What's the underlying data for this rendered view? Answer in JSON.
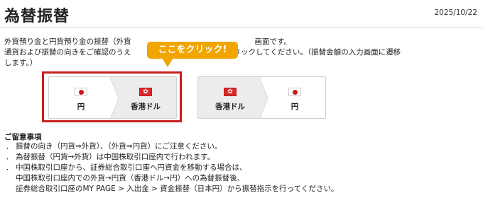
{
  "header": {
    "title": "為替振替",
    "date": "2025/10/22"
  },
  "description": {
    "line1": "外貨預り金と円貨預り金の振替（外貨",
    "line1_tail": "画面です。",
    "line2": "通貨および振替の向きをご確認のうえ",
    "line2_tail": "タンをクリックしてください。（振替金額の入力画面に遷移",
    "line3": "します。）"
  },
  "callout": {
    "text": "ここをクリック!"
  },
  "transfers": [
    {
      "from": {
        "label": "円",
        "flag": "japan-flag"
      },
      "to": {
        "label": "香港ドル",
        "flag": "hong-kong-flag"
      }
    },
    {
      "from": {
        "label": "香港ドル",
        "flag": "hong-kong-flag"
      },
      "to": {
        "label": "円",
        "flag": "japan-flag"
      }
    }
  ],
  "notes": {
    "title": "ご留意事項",
    "bullet": "．",
    "items": [
      {
        "text": "振替の向き（円貨⇒外貨）、（外貨⇒円貨）にご注意ください。"
      },
      {
        "text": "為替振替（円貨→外貨）は中国株取引口座内で行われます。"
      },
      {
        "text": "中国株取引口座から、証券総合取引口座へ円資金を移動する場合は、",
        "text2": "中国株取引口座内での外貨→円貨（香港ドル→円）への為替振替後、",
        "text3": "証券総合取引口座のMY PAGE > 入出金 > 資金振替（日本円）から振替指示を行ってください。"
      }
    ]
  },
  "colors": {
    "accent_callout": "#f0a500",
    "highlight_frame": "#c81e1e",
    "card_bg": "#ececec"
  }
}
